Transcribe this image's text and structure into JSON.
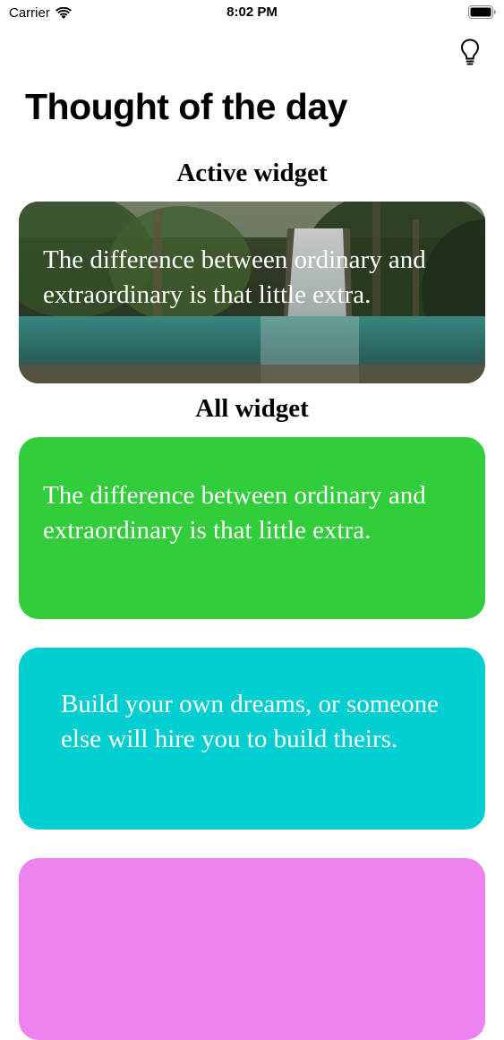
{
  "status_bar": {
    "carrier": "Carrier",
    "time": "8:02 PM"
  },
  "header": {
    "title": "Thought of the day",
    "tips_icon": "lightbulb-icon"
  },
  "active_section": {
    "label": "Active widget",
    "card": {
      "background": "waterfall-photo",
      "quote": "The difference between ordinary and extraordinary is that little extra."
    }
  },
  "all_section": {
    "label": "All widget",
    "cards": [
      {
        "color": "#32cd3a",
        "quote": "The difference between ordinary and extraordinary is that little extra."
      },
      {
        "color": "#00ced1",
        "quote": "Build your own dreams, or someone else will hire you to build theirs."
      },
      {
        "color": "#ee82ee",
        "quote": ""
      }
    ]
  }
}
